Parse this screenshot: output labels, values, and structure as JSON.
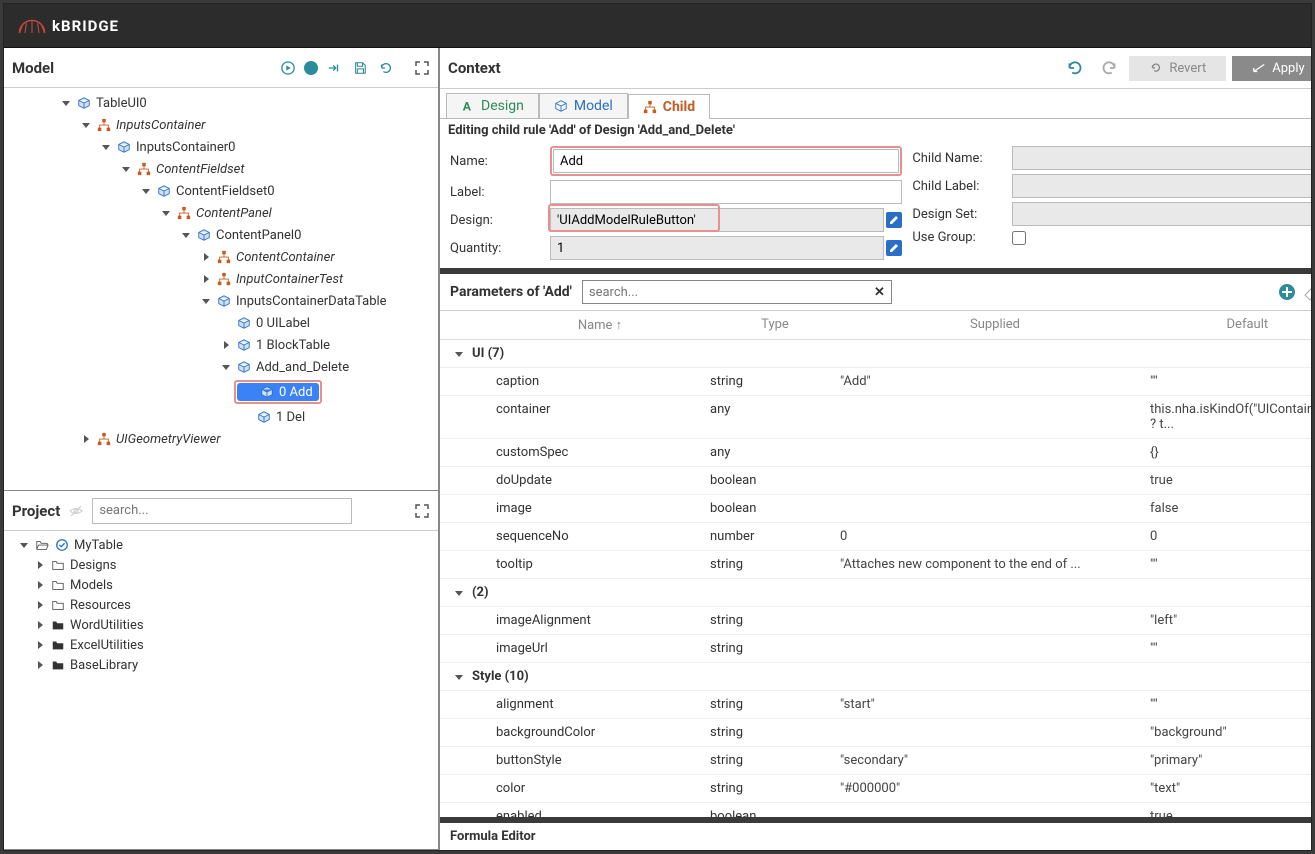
{
  "brand": "kBRIDGE",
  "panels": {
    "model": {
      "title": "Model"
    },
    "project": {
      "title": "Project",
      "search_placeholder": "search..."
    },
    "context": {
      "title": "Context"
    },
    "formula": {
      "title": "Formula Editor"
    }
  },
  "buttons": {
    "revert": "Revert",
    "apply": "Apply"
  },
  "tabs": {
    "design": "Design",
    "model": "Model",
    "child": "Child"
  },
  "editing_line": "Editing child rule 'Add' of Design 'Add_and_Delete'",
  "form": {
    "name_label": "Name:",
    "name_value": "Add",
    "label_label": "Label:",
    "label_value": "",
    "design_label": "Design:",
    "design_value": "'UIAddModelRuleButton'",
    "quantity_label": "Quantity:",
    "quantity_value": "1",
    "child_name_label": "Child Name:",
    "child_name_value": "",
    "child_label_label": "Child Label:",
    "child_label_value": "",
    "design_set_label": "Design Set:",
    "design_set_value": "",
    "use_group_label": "Use Group:"
  },
  "params_header": {
    "title": "Parameters of 'Add'",
    "search_placeholder": "search..."
  },
  "grid_columns": {
    "name": "Name ↑",
    "type": "Type",
    "supplied": "Supplied",
    "default": "Default"
  },
  "groups": {
    "ui": "UI (7)",
    "unnamed": "(2)",
    "style": "Style (10)"
  },
  "rows": {
    "ui": [
      {
        "name": "caption",
        "type": "string",
        "supplied": "\"Add\"",
        "default": "\"\""
      },
      {
        "name": "container",
        "type": "any",
        "supplied": "",
        "default": "this.nha.isKindOf(\"UIContainerMixin\") ? t..."
      },
      {
        "name": "customSpec",
        "type": "any",
        "supplied": "",
        "default": "{}"
      },
      {
        "name": "doUpdate",
        "type": "boolean",
        "supplied": "",
        "default": "true"
      },
      {
        "name": "image",
        "type": "boolean",
        "supplied": "",
        "default": "false"
      },
      {
        "name": "sequenceNo",
        "type": "number",
        "supplied": "0",
        "default": "0"
      },
      {
        "name": "tooltip",
        "type": "string",
        "supplied": "\"Attaches new component to the end of ...",
        "default": "\"\""
      }
    ],
    "unnamed": [
      {
        "name": "imageAlignment",
        "type": "string",
        "supplied": "",
        "default": "\"left\""
      },
      {
        "name": "imageUrl",
        "type": "string",
        "supplied": "",
        "default": "\"\""
      }
    ],
    "style": [
      {
        "name": "alignment",
        "type": "string",
        "supplied": "\"start\"",
        "default": "\"\""
      },
      {
        "name": "backgroundColor",
        "type": "string",
        "supplied": "",
        "default": "\"background\""
      },
      {
        "name": "buttonStyle",
        "type": "string",
        "supplied": "\"secondary\"",
        "default": "\"primary\""
      },
      {
        "name": "color",
        "type": "string",
        "supplied": "\"#000000\"",
        "default": "\"text\""
      },
      {
        "name": "enabled",
        "type": "boolean",
        "supplied": "",
        "default": "true"
      }
    ]
  },
  "model_tree": [
    {
      "indent": 0,
      "toggle": "down",
      "icon": "cube",
      "label": "TableUI0",
      "italic": false
    },
    {
      "indent": 1,
      "toggle": "down",
      "icon": "sitemap",
      "label": "InputsContainer",
      "italic": true
    },
    {
      "indent": 2,
      "toggle": "down",
      "icon": "cube",
      "label": "InputsContainer0",
      "italic": false
    },
    {
      "indent": 3,
      "toggle": "down",
      "icon": "sitemap",
      "label": "ContentFieldset",
      "italic": true
    },
    {
      "indent": 4,
      "toggle": "down",
      "icon": "cube",
      "label": "ContentFieldset0",
      "italic": false
    },
    {
      "indent": 5,
      "toggle": "down",
      "icon": "sitemap",
      "label": "ContentPanel",
      "italic": true
    },
    {
      "indent": 6,
      "toggle": "down",
      "icon": "cube",
      "label": "ContentPanel0",
      "italic": false
    },
    {
      "indent": 7,
      "toggle": "right",
      "icon": "sitemap",
      "label": "ContentContainer",
      "italic": true
    },
    {
      "indent": 7,
      "toggle": "right",
      "icon": "sitemap",
      "label": "InputContainerTest",
      "italic": true
    },
    {
      "indent": 7,
      "toggle": "down",
      "icon": "cube",
      "label": "InputsContainerDataTable",
      "italic": false
    },
    {
      "indent": 8,
      "toggle": "blank",
      "icon": "cube",
      "label": "0 UILabel",
      "italic": false
    },
    {
      "indent": 8,
      "toggle": "right",
      "icon": "cube",
      "label": "1 BlockTable",
      "italic": false
    },
    {
      "indent": 8,
      "toggle": "down",
      "icon": "cube",
      "label": "Add_and_Delete",
      "italic": false
    },
    {
      "indent": 8,
      "toggle": "blank",
      "icon": "cube",
      "label": "0 Add",
      "italic": false,
      "selected": true,
      "extraIndent": 20,
      "highlight": true
    },
    {
      "indent": 8,
      "toggle": "blank",
      "icon": "cube",
      "label": "1 Del",
      "italic": false,
      "extraIndent": 20
    },
    {
      "indent": 1,
      "toggle": "right",
      "icon": "sitemap",
      "label": "UIGeometryViewer",
      "italic": true
    }
  ],
  "project_tree": [
    {
      "indent": "p",
      "toggle": "down",
      "icon": "folder-open",
      "secondary": "check",
      "label": "MyTable"
    },
    {
      "indent": "p1",
      "toggle": "right",
      "icon": "folder",
      "label": "Designs"
    },
    {
      "indent": "p1",
      "toggle": "right",
      "icon": "folder",
      "label": "Models"
    },
    {
      "indent": "p1",
      "toggle": "right",
      "icon": "folder",
      "label": "Resources"
    },
    {
      "indent": "p1",
      "toggle": "right",
      "icon": "folder-solid",
      "label": "WordUtilities"
    },
    {
      "indent": "p1",
      "toggle": "right",
      "icon": "folder-solid",
      "label": "ExcelUtilities"
    },
    {
      "indent": "p1",
      "toggle": "right",
      "icon": "folder-solid",
      "label": "BaseLibrary"
    }
  ]
}
